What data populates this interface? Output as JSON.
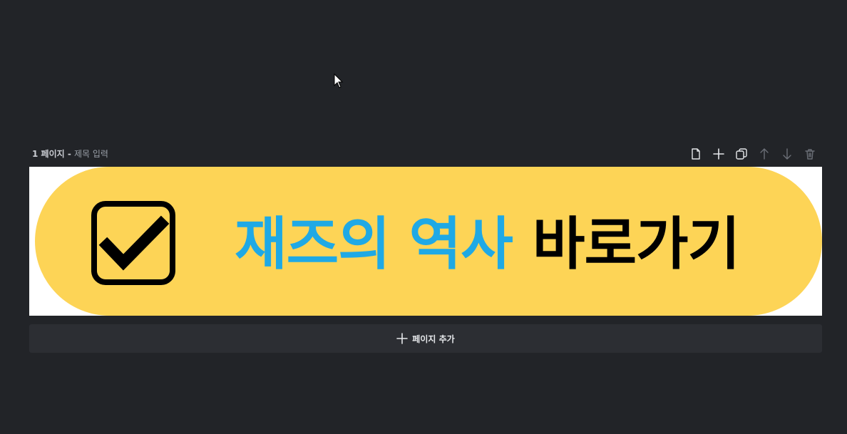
{
  "page_header": {
    "page_number": "1 페이지",
    "separator": " - ",
    "title_placeholder": "제목 입력"
  },
  "toolbar": {
    "icons": [
      "new-page-icon",
      "plus-icon",
      "duplicate-icon",
      "arrow-up-icon",
      "arrow-down-icon",
      "trash-icon"
    ]
  },
  "banner": {
    "text_highlight": "재즈의 역사",
    "text_normal": "바로가기",
    "colors": {
      "background": "#fdd456",
      "highlight": "#1fa9e5",
      "normal": "#000000"
    }
  },
  "add_page": {
    "label": "페이지 추가"
  }
}
